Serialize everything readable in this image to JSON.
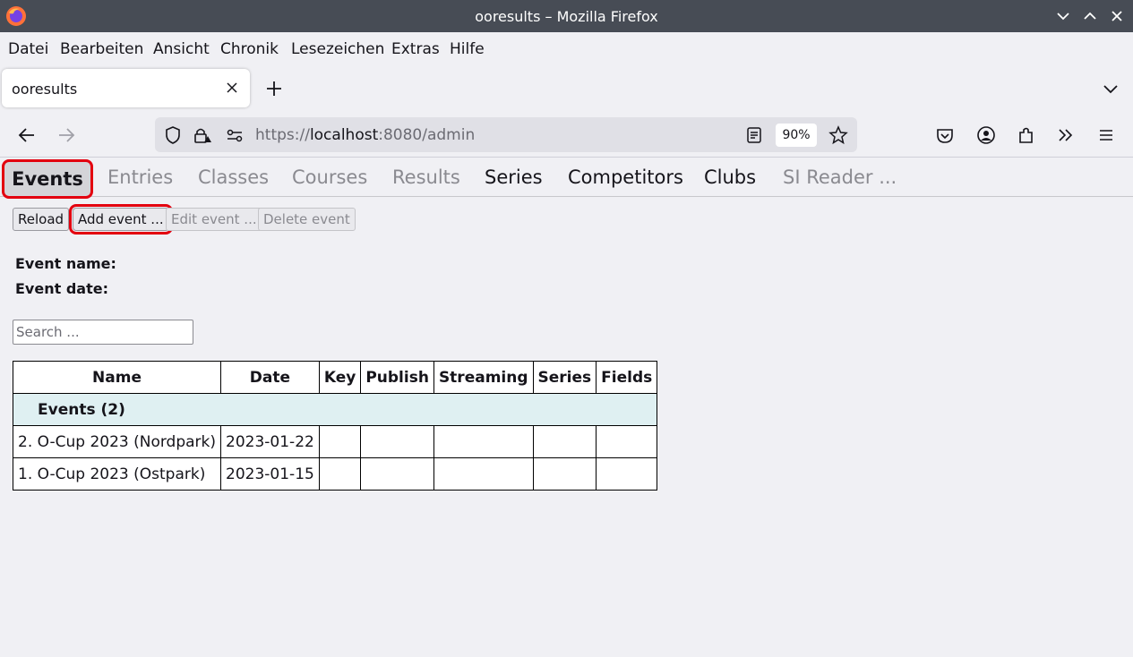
{
  "window": {
    "title": "ooresults – Mozilla Firefox"
  },
  "menu": {
    "items": [
      {
        "label": "Datei"
      },
      {
        "label": "Bearbeiten"
      },
      {
        "label": "Ansicht"
      },
      {
        "label": "Chronik"
      },
      {
        "label": "Lesezeichen"
      },
      {
        "label": "Extras"
      },
      {
        "label": "Hilfe"
      }
    ]
  },
  "browser_tab": {
    "title": "ooresults"
  },
  "urlbar": {
    "prefix": "https://",
    "host": "localhost",
    "suffix": ":8080/admin",
    "zoom": "90%"
  },
  "app": {
    "tabs": [
      {
        "label": "Events",
        "state": "active"
      },
      {
        "label": "Entries",
        "state": "disabled"
      },
      {
        "label": "Classes",
        "state": "disabled"
      },
      {
        "label": "Courses",
        "state": "disabled"
      },
      {
        "label": "Results",
        "state": "disabled"
      },
      {
        "label": "Series",
        "state": "enabled"
      },
      {
        "label": "Competitors",
        "state": "enabled"
      },
      {
        "label": "Clubs",
        "state": "enabled"
      },
      {
        "label": "SI Reader ...",
        "state": "disabled"
      }
    ],
    "buttons": {
      "reload": "Reload",
      "add": "Add event ...",
      "edit": "Edit event ...",
      "delete": "Delete event"
    },
    "event_name_label": "Event name:",
    "event_date_label": "Event date:",
    "search_placeholder": "Search ...",
    "table": {
      "columns": [
        "Name",
        "Date",
        "Key",
        "Publish",
        "Streaming",
        "Series",
        "Fields"
      ],
      "group_label": "Events  (2)",
      "rows": [
        {
          "name": "2. O-Cup 2023 (Nordpark)",
          "date": "2023-01-22",
          "key": "",
          "publish": "",
          "streaming": "",
          "series": "",
          "fields": ""
        },
        {
          "name": "1. O-Cup 2023 (Ostpark)",
          "date": "2023-01-15",
          "key": "",
          "publish": "",
          "streaming": "",
          "series": "",
          "fields": ""
        }
      ]
    }
  },
  "colors": {
    "titlebar": "#474c55",
    "highlight": "#e3000f",
    "group_row": "#dff0f2"
  }
}
